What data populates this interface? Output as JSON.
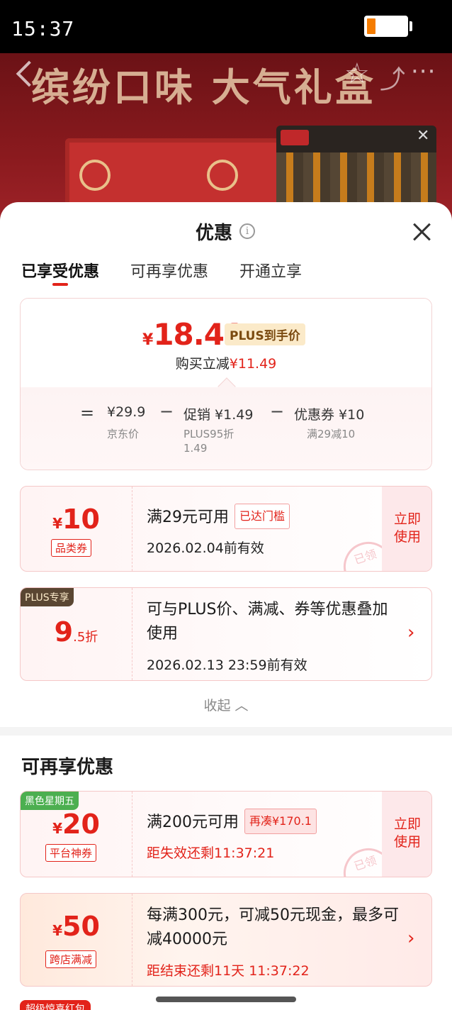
{
  "status_bar": {
    "time": "15:37"
  },
  "backdrop": {
    "banner_text": "缤纷口味 大气礼盒"
  },
  "sheet": {
    "title": "优惠",
    "tabs": [
      "已享受优惠",
      "可再享优惠",
      "开通立享"
    ],
    "active_tab": "已享受优惠",
    "summary": {
      "currency": "¥",
      "final_price": "18.41",
      "price_tag": "PLUS到手价",
      "save_label": "购买立减",
      "save_amount": "¥11.49",
      "equals": "=",
      "minus": "−",
      "jd_price": "¥29.9",
      "jd_price_label": "京东价",
      "promo_value": "促销 ¥1.49",
      "promo_sub_1": "PLUS95折",
      "promo_sub_2": "1.49",
      "coupon_value": "优惠券 ¥10",
      "coupon_sub": "满29减10"
    },
    "coupons_used": [
      {
        "currency": "¥",
        "amount": "10",
        "type_tag": "品类券",
        "condition": "满29元可用",
        "status_tag": "已达门槛",
        "validity": "2026.02.04前有效",
        "action": "立即使用",
        "stamp": "已领"
      },
      {
        "corner_tag": "PLUS专享",
        "amount": "9",
        "amount_suffix": ".5折",
        "description": "可与PLUS价、满减、券等优惠叠加使用",
        "validity": "2026.02.13 23:59前有效"
      }
    ],
    "collapse_label": "收起",
    "more_section_title": "可再享优惠",
    "coupons_more": [
      {
        "corner_tag": "黑色星期五",
        "currency": "¥",
        "amount": "20",
        "type_tag": "平台神券",
        "condition": "满200元可用",
        "status_tag": "再凑¥170.1",
        "countdown": "距失效还剩11:37:21",
        "action": "立即使用",
        "stamp": "已领"
      },
      {
        "currency": "¥",
        "amount": "50",
        "type_tag": "跨店满减",
        "description": "每满300元，可减50元现金，最多可减40000元",
        "countdown": "距结束还剩11天 11:37:22"
      }
    ],
    "peek_tag": "超级惊喜红包"
  },
  "colors": {
    "accent": "#e2231a",
    "plus_gold": "#fbeac9",
    "plus_dark": "#5a4632",
    "black_friday": "#4caf50"
  },
  "icons": [
    "back-icon",
    "star-icon",
    "share-icon",
    "more-icon",
    "info-icon",
    "close-icon",
    "chevron-up-icon",
    "chevron-right-icon"
  ]
}
